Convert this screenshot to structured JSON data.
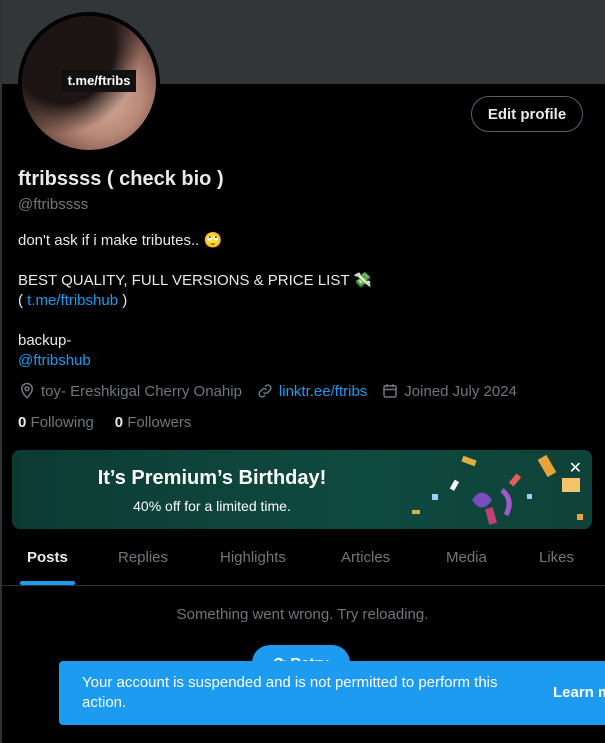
{
  "profile": {
    "avatar_text": "t.me/ftribs",
    "name": "ftribssss ( check bio )",
    "handle": "@ftribssss",
    "edit_label": "Edit profile",
    "bio_line1": "don't ask if i make tributes.. 🙄",
    "bio_line2": "BEST QUALITY, FULL VERSIONS & PRICE LIST 💸",
    "bio_paren_open": "(",
    "bio_link1": "t.me/ftribshub",
    "bio_paren_close": ")",
    "bio_line4": "backup-",
    "bio_mention": "@ftribshub",
    "location": "toy- Ereshkigal Cherry Onahip",
    "website": "linktr.ee/ftribs",
    "joined": "Joined July 2024",
    "following_count": "0",
    "following_label": "Following",
    "followers_count": "0",
    "followers_label": "Followers"
  },
  "promo": {
    "title": "It’s Premium’s Birthday!",
    "subtitle": "40% off for a limited time.",
    "close": "✕"
  },
  "tabs": [
    "Posts",
    "Replies",
    "Highlights",
    "Articles",
    "Media",
    "Likes"
  ],
  "timeline": {
    "error": "Something went wrong. Try reloading.",
    "retry": "Retry"
  },
  "toast": {
    "message": "Your account is suspended and is not permitted to perform this action.",
    "learn_more": "Learn more"
  },
  "colors": {
    "accent": "#1d9bf0",
    "muted": "#71767b",
    "promo_bg": "#0f4a40"
  }
}
